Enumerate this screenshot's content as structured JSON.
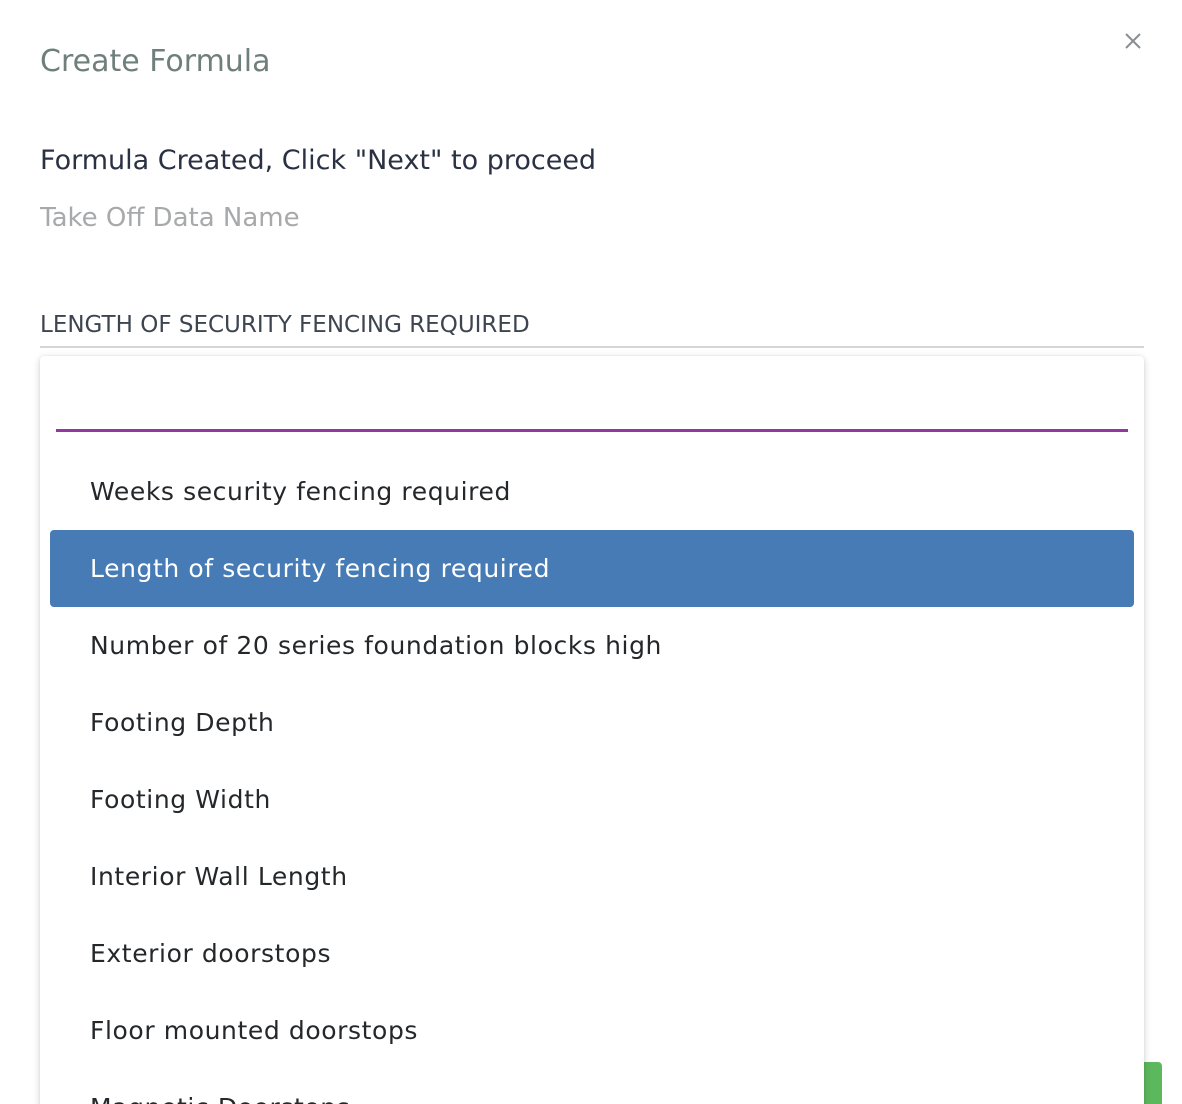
{
  "modal": {
    "title": "Create Formula",
    "status": "Formula Created, Click \"Next\" to proceed",
    "field_label": "Take Off Data Name"
  },
  "select": {
    "value": "LENGTH OF SECURITY FENCING REQUIRED",
    "search_value": ""
  },
  "options": [
    {
      "label": "Weeks security fencing required"
    },
    {
      "label": "Length of security fencing required",
      "selected": true
    },
    {
      "label": "Number of 20 series foundation blocks high"
    },
    {
      "label": "Footing Depth"
    },
    {
      "label": "Footing Width"
    },
    {
      "label": "Interior Wall Length"
    },
    {
      "label": "Exterior doorstops"
    },
    {
      "label": "Floor mounted doorstops"
    },
    {
      "label": "Magnetic Doorstops"
    }
  ],
  "icons": {
    "close": "close-icon"
  },
  "colors": {
    "accent_purple": "#93399d",
    "selected_bg": "#477bb5",
    "button_green": "#5cb85c"
  }
}
